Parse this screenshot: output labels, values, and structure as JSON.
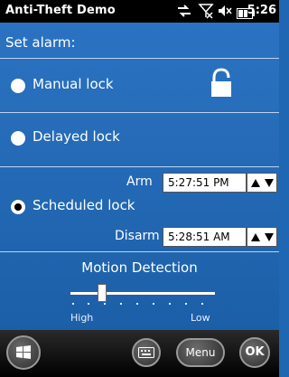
{
  "statusbar": {
    "title": "Anti-Theft Demo",
    "time": "5:26",
    "icons": [
      "data-transfer-icon",
      "no-signal-icon",
      "volume-muted-icon",
      "battery-icon"
    ]
  },
  "main": {
    "section_title": "Set alarm:",
    "options": [
      {
        "label": "Manual lock",
        "selected": false
      },
      {
        "label": "Delayed lock",
        "selected": false
      },
      {
        "label": "Scheduled lock",
        "selected": true
      }
    ],
    "arm": {
      "label": "Arm",
      "value": "5:27:51 PM"
    },
    "disarm": {
      "label": "Disarm",
      "value": "5:28:51 AM"
    },
    "motion": {
      "title": "Motion Detection",
      "low_label": "Low",
      "high_label": "High",
      "level": 0.2
    }
  },
  "bottombar": {
    "menu_label": "Menu",
    "ok_label": "OK"
  },
  "colors": {
    "background": "#1f66b3",
    "statusbar": "#000000"
  }
}
